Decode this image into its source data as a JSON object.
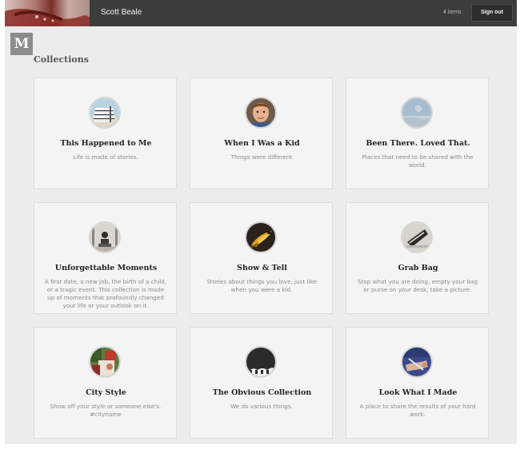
{
  "header": {
    "user_name": "Scott Beale",
    "item_count": "4 items",
    "signout_label": "Sign out"
  },
  "logo": {
    "letter": "M"
  },
  "page": {
    "title": "Collections"
  },
  "collections": [
    {
      "title": "This Happened to Me",
      "description": "Life is made of stories.",
      "icon": "stacked-books-image"
    },
    {
      "title": "When I Was a Kid",
      "description": "Things were different",
      "icon": "child-portrait-image"
    },
    {
      "title": "Been There. Loved That.",
      "description": "Places that need to be shared with the world.",
      "icon": "sky-landscape-image"
    },
    {
      "title": "Unforgettable Moments",
      "description": "A first date, a new job, the birth of a child, or a tragic event. This collection is made up of moments that profoundly changed your life or your outlook on it.",
      "icon": "monument-image"
    },
    {
      "title": "Show & Tell",
      "description": "Stories about things you love, just like when you were a kid.",
      "icon": "bird-image"
    },
    {
      "title": "Grab Bag",
      "description": "Stop what you are doing, empty your bag or purse on your desk, take a picture.",
      "icon": "bag-contents-image"
    },
    {
      "title": "City Style",
      "description": "Show off your style or someone else's. #cityname",
      "icon": "street-style-image"
    },
    {
      "title": "The Obvious Collection",
      "description": "We do various things.",
      "icon": "obvious-logo-image"
    },
    {
      "title": "Look What I Made",
      "description": "A place to share the results of your hard work.",
      "icon": "handmade-craft-image"
    }
  ]
}
